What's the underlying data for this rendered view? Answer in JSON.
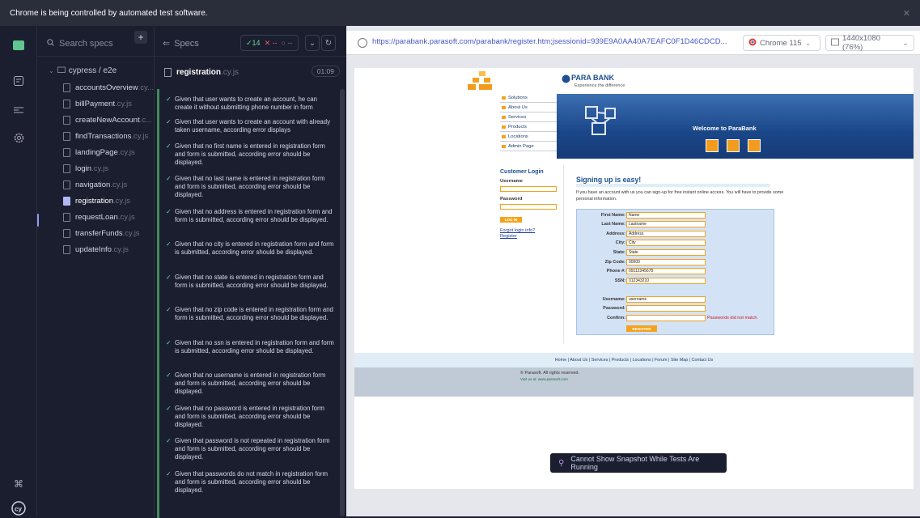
{
  "banner": {
    "text": "Chrome is being controlled by automated test software.",
    "close": "✕"
  },
  "rail": {
    "icons": [
      "specs-icon",
      "runs-icon",
      "debug-icon",
      "settings-icon",
      "keyboard-shortcuts-icon",
      "cypress-logo-icon"
    ]
  },
  "speclist": {
    "search_placeholder": "Search specs",
    "add_label": "+",
    "folder": "cypress / e2e",
    "items": [
      {
        "name": "accountsOverview",
        "ext": ".cy..."
      },
      {
        "name": "billPayment",
        "ext": ".cy.js"
      },
      {
        "name": "createNewAccount",
        "ext": ".c..."
      },
      {
        "name": "findTransactions",
        "ext": ".cy.js"
      },
      {
        "name": "landingPage",
        "ext": ".cy.js"
      },
      {
        "name": "login",
        "ext": ".cy.js"
      },
      {
        "name": "navigation",
        "ext": ".cy.js"
      },
      {
        "name": "registration",
        "ext": ".cy.js"
      },
      {
        "name": "requestLoan",
        "ext": ".cy.js"
      },
      {
        "name": "transferFunds",
        "ext": ".cy.js"
      },
      {
        "name": "updateInfo",
        "ext": ".cy.js"
      }
    ]
  },
  "reporter": {
    "title": "Specs",
    "passed": "✓14",
    "failed": "✕ --",
    "pending": "○ --",
    "spec_name": "registration",
    "spec_ext": ".cy.js",
    "duration": "01:09",
    "tests": [
      "Given that user wants to create an account, he can create it without submitting phone number in form",
      "Given that user wants to create an account with already taken username, according error displays",
      "Given that no first name is entered in registration form and form is submitted, according error should be displayed.",
      "Given that no last name is entered in registration form and form is submitted, according error should be displayed.",
      "Given that no address is entered in registration form and form is submitted, according error should be displayed.",
      "Given that no city is entered in registration form and form is submitted, according error should be displayed.",
      "Given that no state is entered in registration form and form is submitted, according error should be displayed.",
      "Given that no zip code is entered in registration form and form is submitted, according error should be displayed.",
      "Given that no ssn is entered in registration form and form is submitted, according error should be displayed.",
      "Given that no username is entered in registration form and form is submitted, according error should be displayed.",
      "Given that no password is entered in registration form and form is submitted, according error should be displayed.",
      "Given that password is not repeated in registration form and form is submitted, according error should be displayed.",
      "Given that passwords do not match in registration form and form is submitted, according error should be displayed."
    ]
  },
  "aut": {
    "url": "https://parabank.parasoft.com/parabank/register.htm;jsessionid=939E9A0AA40A7EAFC0F1D46CDCD...",
    "browser": "Chrome 115",
    "viewport": "1440x1080 (76%)",
    "toast": "Cannot Show Snapshot While Tests Are Running"
  },
  "parabank": {
    "logo": "PARA BANK",
    "tagline": "Experience the difference",
    "menu": [
      "Solutions",
      "About Us",
      "Services",
      "Products",
      "Locations",
      "Admin Page"
    ],
    "welcome": "Welcome to ParaBank",
    "login": {
      "title": "Customer Login",
      "username_label": "Username",
      "password_label": "Password",
      "button": "LOG IN",
      "forgot": "Forgot login info?",
      "register": "Register"
    },
    "signup_title": "Signing up is easy!",
    "signup_intro": "If you have an account with us you can sign-up for free instant online access. You will have to provide some personal information.",
    "form": [
      {
        "label": "First Name:",
        "value": "Name"
      },
      {
        "label": "Last Name:",
        "value": "Lastname"
      },
      {
        "label": "Address:",
        "value": "Address"
      },
      {
        "label": "City:",
        "value": "City"
      },
      {
        "label": "State:",
        "value": "State"
      },
      {
        "label": "Zip Code:",
        "value": "00000"
      },
      {
        "label": "Phone #:",
        "value": "09112345678"
      },
      {
        "label": "SSN:",
        "value": "012343210"
      },
      {
        "label": "Username:",
        "value": "username"
      },
      {
        "label": "Password:",
        "value": ""
      },
      {
        "label": "Confirm:",
        "value": ""
      }
    ],
    "password_error": "Passwords did not match.",
    "register_button": "REGISTER",
    "footer_links": "Home  |  About Us  |  Services  |  Products  |  Locations  |  Forum  |  Site Map  |  Contact Us",
    "copyright": "© Parasoft. All rights reserved.",
    "visit": "Visit us at: www.parasoft.com"
  }
}
